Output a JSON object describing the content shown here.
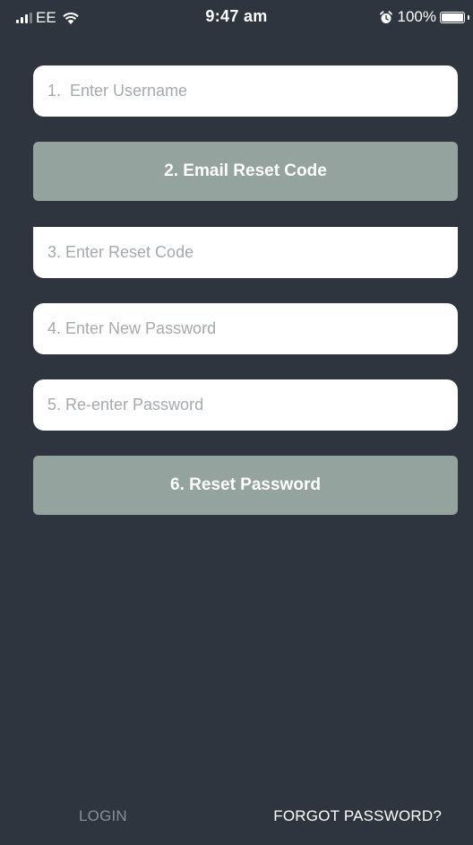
{
  "status_bar": {
    "carrier": "EE",
    "time": "9:47 am",
    "battery_percent": "100%",
    "battery_level": 1.0,
    "icons": [
      "signal-icon",
      "wifi-icon",
      "alarm-icon",
      "battery-icon"
    ]
  },
  "form": {
    "username_placeholder": "1.  Enter Username",
    "email_button_label": "2. Email Reset Code",
    "reset_code_placeholder": "3. Enter Reset Code",
    "new_password_placeholder": "4. Enter New Password",
    "reenter_password_placeholder": "5. Re-enter Password",
    "reset_button_label": "6. Reset Password"
  },
  "footer": {
    "login_label": "LOGIN",
    "forgot_label": "FORGOT PASSWORD?"
  },
  "colors": {
    "background": "#2f353e",
    "button": "#95a39f",
    "field": "#ffffff",
    "placeholder": "#a6a9ae",
    "inactive_link": "#8a8f96",
    "active_link": "#ffffff"
  }
}
